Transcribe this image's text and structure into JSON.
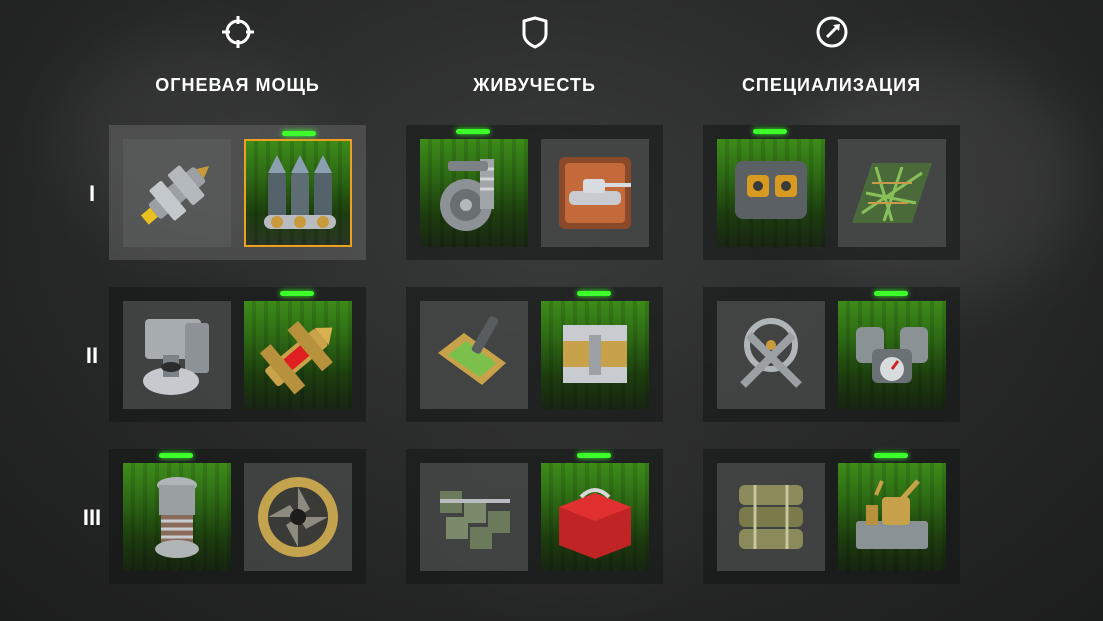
{
  "columns": [
    {
      "id": "firepower",
      "title": "ОГНЕВАЯ МОЩЬ",
      "icon": "crosshair-icon"
    },
    {
      "id": "survivability",
      "title": "ЖИВУЧЕСТЬ",
      "icon": "shield-icon"
    },
    {
      "id": "specialization",
      "title": "СПЕЦИАЛИЗАЦИЯ",
      "icon": "gauge-icon"
    }
  ],
  "tiers": [
    "I",
    "II",
    "III"
  ],
  "modules": {
    "firepower": [
      [
        {
          "icon": "shell-rammer-icon",
          "active": false
        },
        {
          "icon": "triple-shell-icon",
          "active": true,
          "focused": true
        }
      ],
      [
        {
          "icon": "gun-mechanism-icon",
          "active": false
        },
        {
          "icon": "red-shell-icon",
          "active": true
        }
      ],
      [
        {
          "icon": "spring-cylinder-icon",
          "active": true
        },
        {
          "icon": "aperture-icon",
          "active": false
        }
      ]
    ],
    "survivability": [
      [
        {
          "icon": "suspension-icon",
          "active": true
        },
        {
          "icon": "tank-badge-icon",
          "active": false
        }
      ],
      [
        {
          "icon": "armor-plate-icon",
          "active": false
        },
        {
          "icon": "armor-joint-icon",
          "active": true
        }
      ],
      [
        {
          "icon": "tracks-icon",
          "active": false
        },
        {
          "icon": "toolbox-icon",
          "active": true
        }
      ]
    ],
    "specialization": [
      [
        {
          "icon": "optics-icon",
          "active": true
        },
        {
          "icon": "camo-net-icon",
          "active": false
        }
      ],
      [
        {
          "icon": "wrench-icon",
          "active": false
        },
        {
          "icon": "engine-icon",
          "active": true
        }
      ],
      [
        {
          "icon": "ammo-rack-icon",
          "active": false
        },
        {
          "icon": "tool-kit-icon",
          "active": true
        }
      ]
    ]
  },
  "colors": {
    "active_bar": "#3dff2a",
    "focus_border": "#f0a020",
    "active_bg": "#2d6914"
  }
}
